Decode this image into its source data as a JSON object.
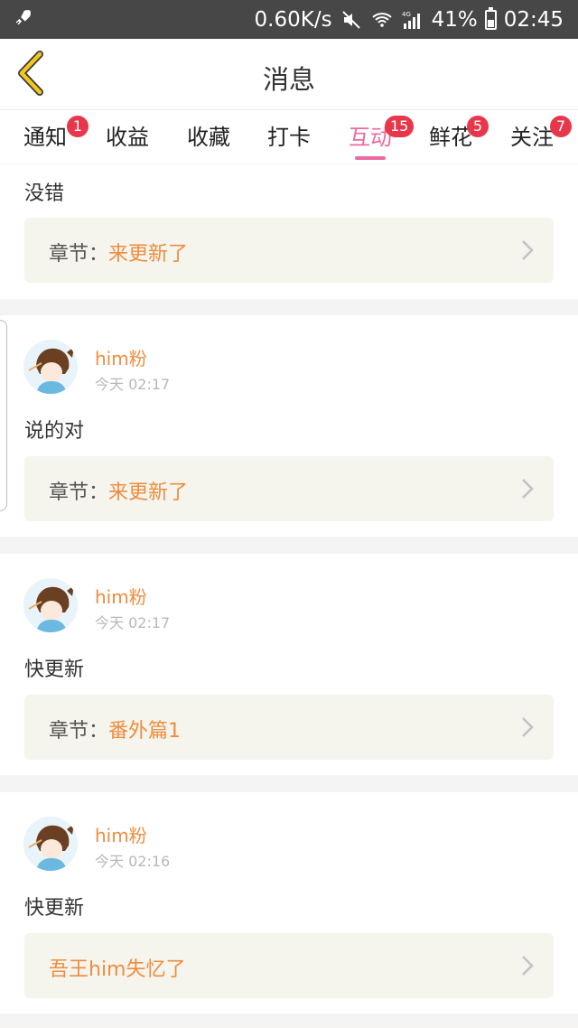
{
  "status_bar": {
    "speed": "0.60K/s",
    "network": "4G",
    "battery": "41%",
    "time": "02:45"
  },
  "header": {
    "title": "消息"
  },
  "tabs": [
    {
      "label": "通知",
      "badge": "1"
    },
    {
      "label": "收益",
      "badge": ""
    },
    {
      "label": "收藏",
      "badge": ""
    },
    {
      "label": "打卡",
      "badge": ""
    },
    {
      "label": "互动",
      "badge": "15",
      "active": true
    },
    {
      "label": "鲜花",
      "badge": "5"
    },
    {
      "label": "关注",
      "badge": "7"
    }
  ],
  "items": [
    {
      "comment": "没错",
      "ref_prefix": "章节：",
      "ref_value": "来更新了"
    },
    {
      "user": "him粉",
      "time": "今天 02:17",
      "comment": "说的对",
      "ref_prefix": "章节：",
      "ref_value": "来更新了"
    },
    {
      "user": "him粉",
      "time": "今天 02:17",
      "comment": "快更新",
      "ref_prefix": "章节：",
      "ref_value": "番外篇1"
    },
    {
      "user": "him粉",
      "time": "今天 02:16",
      "comment": "快更新",
      "ref_prefix": "",
      "ref_value": "吾王him失忆了"
    }
  ],
  "colors": {
    "accent": "#ec6a9d",
    "orange": "#ee8d3e",
    "badge": "#e8374a",
    "back_arrow": "#f2c81c"
  }
}
